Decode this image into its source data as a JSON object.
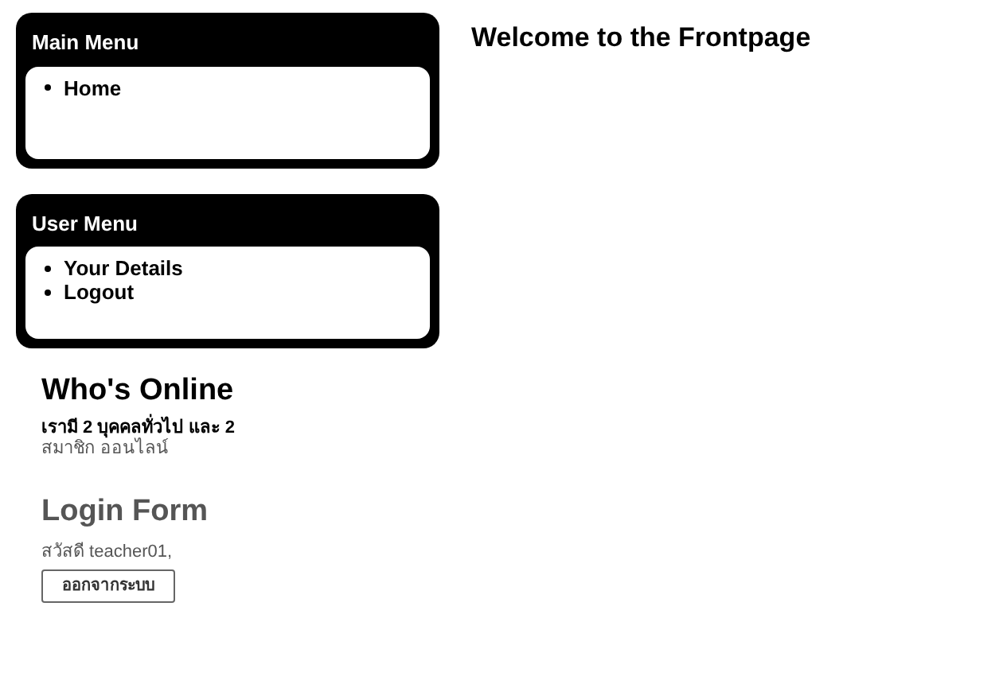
{
  "menus": [
    {
      "title": "Main Menu",
      "items": [
        {
          "label": "Home"
        }
      ]
    },
    {
      "title": "User Menu",
      "items": [
        {
          "label": "Your Details"
        },
        {
          "label": "Logout"
        }
      ]
    }
  ],
  "whos_online": {
    "title": "Who's Online",
    "line_1": "เรามี 2 บุคคลทั่วไป และ 2",
    "line_2": "สมาชิก ออนไลน์"
  },
  "login_form": {
    "title": "Login Form",
    "greeting": "สวัสดี teacher01,",
    "button": "ออกจากระบบ"
  },
  "main": {
    "title": "Welcome to the Frontpage"
  }
}
